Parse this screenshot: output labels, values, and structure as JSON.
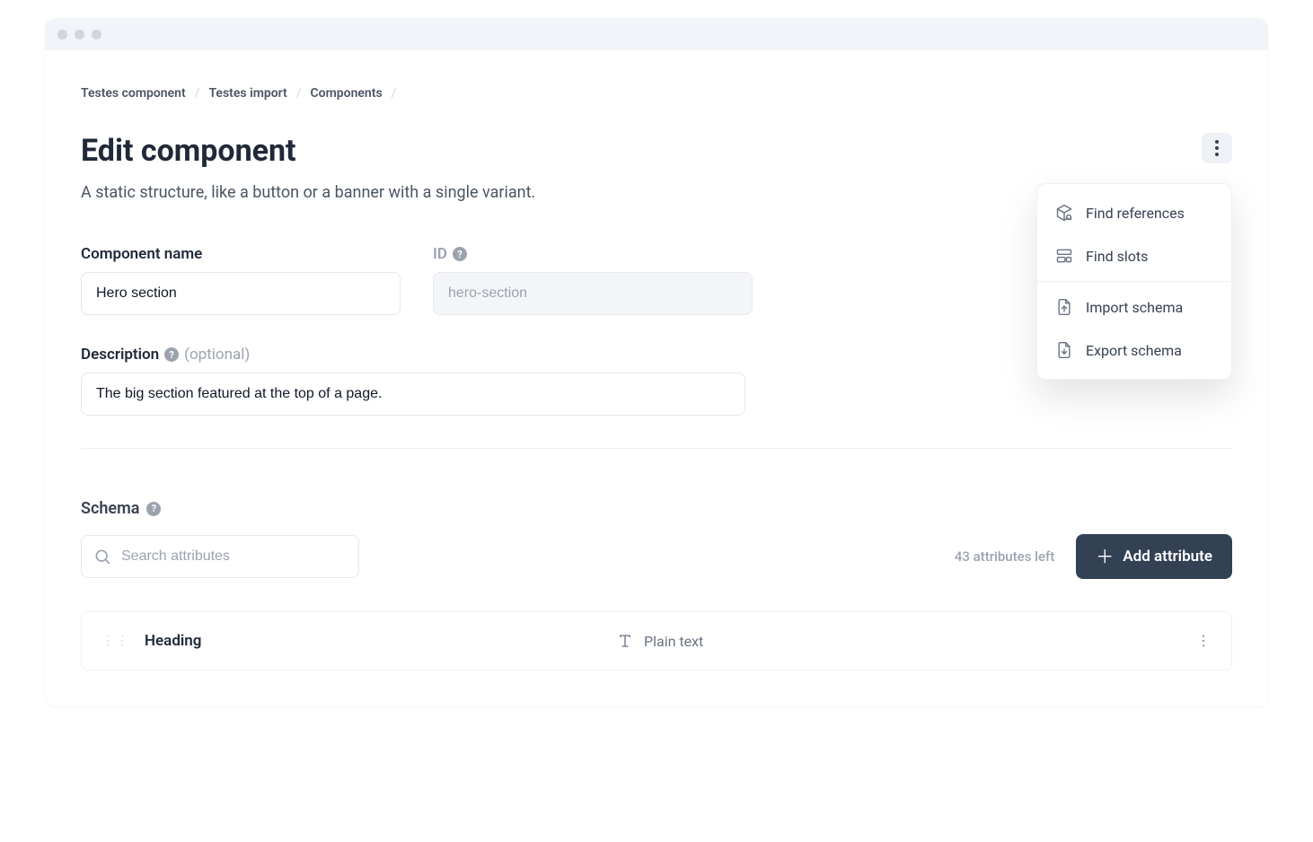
{
  "breadcrumbs": [
    "Testes component",
    "Testes import",
    "Components"
  ],
  "page": {
    "title": "Edit component",
    "subtitle": "A static structure, like a button or a banner with a single variant."
  },
  "menu": {
    "find_references": "Find references",
    "find_slots": "Find slots",
    "import_schema": "Import schema",
    "export_schema": "Export schema"
  },
  "fields": {
    "component_name_label": "Component name",
    "component_name_value": "Hero section",
    "id_label": "ID",
    "id_value": "hero-section",
    "description_label": "Description",
    "description_optional": "(optional)",
    "description_value": "The big section featured at the top of a page."
  },
  "schema": {
    "label": "Schema",
    "search_placeholder": "Search attributes",
    "attributes_left": "43 attributes left",
    "add_attribute_label": "Add attribute",
    "rows": [
      {
        "name": "Heading",
        "type": "Plain text"
      }
    ]
  }
}
